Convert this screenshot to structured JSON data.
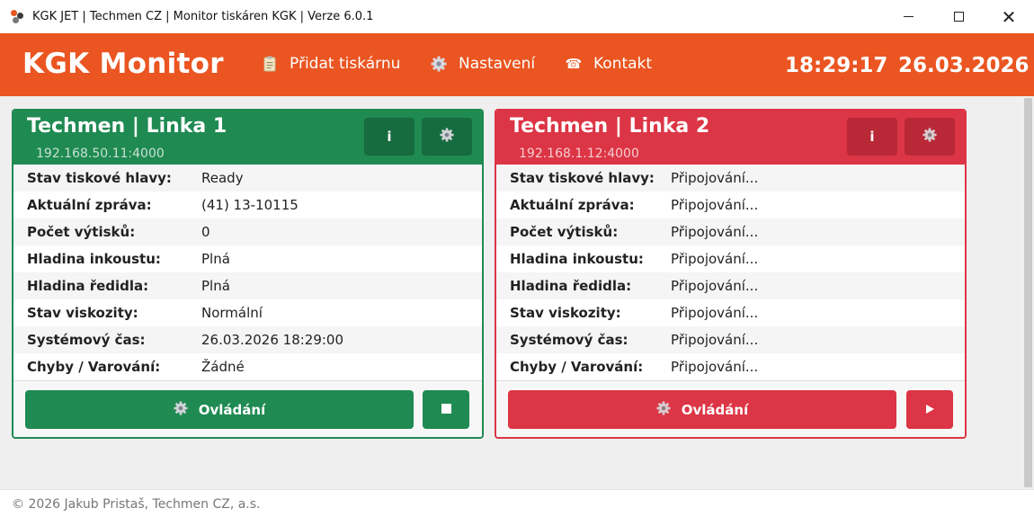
{
  "window": {
    "title": "KGK JET | Techmen CZ | Monitor tiskáren KGK | Verze 6.0.1",
    "minimize": "—",
    "maximize": "☐",
    "close": "✕"
  },
  "header": {
    "brand": "KGK Monitor",
    "nav": [
      {
        "label": "Přidat tiskárnu",
        "icon": "clipboard-icon"
      },
      {
        "label": "Nastavení",
        "icon": "gear-icon"
      },
      {
        "label": "Kontakt",
        "icon": "phone-icon"
      }
    ],
    "time": "18:29:17",
    "date": "26.03.2026"
  },
  "printers": [
    {
      "name": "Techmen | Linka 1",
      "ip": "192.168.50.11:4000",
      "status_color": "#1f8a52",
      "info_label": "i",
      "rows": [
        {
          "label": "Stav tiskové hlavy:",
          "value": "Ready"
        },
        {
          "label": "Aktuální zpráva:",
          "value": "(41)  13-10115"
        },
        {
          "label": "Počet výtisků:",
          "value": "0"
        },
        {
          "label": "Hladina inkoustu:",
          "value": "Plná"
        },
        {
          "label": "Hladina ředidla:",
          "value": "Plná"
        },
        {
          "label": "Stav viskozity:",
          "value": "Normální"
        },
        {
          "label": "Systémový čas:",
          "value": "26.03.2026 18:29:00"
        },
        {
          "label": "Chyby / Varování:",
          "value": "Žádné"
        }
      ],
      "control_label": "Ovládání",
      "action_icon": "stop-icon"
    },
    {
      "name": "Techmen | Linka 2",
      "ip": "192.168.1.12:4000",
      "status_color": "#dc3545",
      "info_label": "i",
      "rows": [
        {
          "label": "Stav tiskové hlavy:",
          "value": "Připojování..."
        },
        {
          "label": "Aktuální zpráva:",
          "value": "Připojování..."
        },
        {
          "label": "Počet výtisků:",
          "value": "Připojování..."
        },
        {
          "label": "Hladina inkoustu:",
          "value": "Připojování..."
        },
        {
          "label": "Hladina ředidla:",
          "value": "Připojování..."
        },
        {
          "label": "Stav viskozity:",
          "value": "Připojování..."
        },
        {
          "label": "Systémový čas:",
          "value": "Připojování..."
        },
        {
          "label": "Chyby / Varování:",
          "value": "Připojování..."
        }
      ],
      "control_label": "Ovládání",
      "action_icon": "play-icon"
    }
  ],
  "footer": {
    "copyright": "© 2026 Jakub Pristaš, Techmen CZ, a.s."
  }
}
